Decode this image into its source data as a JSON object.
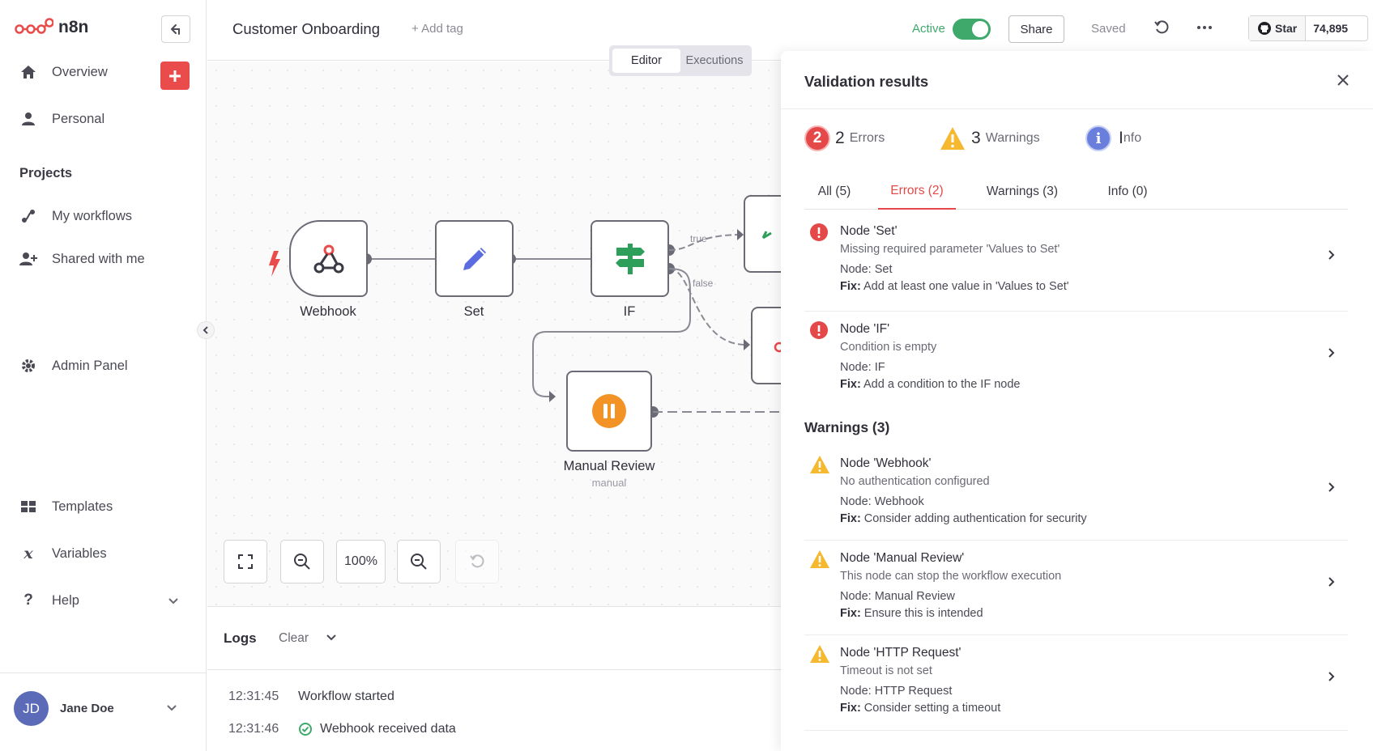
{
  "app": {
    "brand": "n8n"
  },
  "sidebar": {
    "items": [
      {
        "label": "Overview",
        "icon": "home-icon"
      },
      {
        "label": "Personal",
        "icon": "user-icon"
      }
    ],
    "projects_title": "Projects",
    "project_items": [
      {
        "label": "My workflows",
        "icon": "workflow-icon"
      },
      {
        "label": "Shared with me",
        "icon": "user-plus-icon"
      }
    ],
    "admin": {
      "label": "Admin Panel",
      "icon": "gear-icon"
    },
    "bottom_items": [
      {
        "label": "Templates",
        "icon": "box-icon"
      },
      {
        "label": "Variables",
        "icon": "variable-icon"
      },
      {
        "label": "Help",
        "icon": "question-icon"
      }
    ],
    "user": {
      "initials": "JD",
      "name": "Jane Doe"
    }
  },
  "header": {
    "workflow_name": "Customer Onboarding",
    "add_tag": "+ Add tag",
    "active_label": "Active",
    "active": true,
    "share_label": "Share",
    "saved_label": "Saved",
    "github": {
      "star_label": "Star",
      "count": "74,895"
    }
  },
  "view_tabs": {
    "editor": "Editor",
    "executions": "Executions",
    "selected": "Editor"
  },
  "canvas": {
    "nodes": [
      {
        "id": "webhook",
        "label": "Webhook"
      },
      {
        "id": "set",
        "label": "Set"
      },
      {
        "id": "if",
        "label": "IF"
      },
      {
        "id": "manual-review",
        "label": "Manual Review",
        "sublabel": "manual"
      }
    ],
    "edge_labels": {
      "true": "true",
      "false": "false"
    },
    "zoom_label": "100%"
  },
  "logs": {
    "title": "Logs",
    "clear_label": "Clear",
    "entries": [
      {
        "time": "12:31:45",
        "message": "Workflow started",
        "status": ""
      },
      {
        "time": "12:31:46",
        "message": "Webhook received data",
        "status": "success"
      }
    ]
  },
  "validation": {
    "title": "Validation results",
    "summary": {
      "errors": {
        "count": "2",
        "label": "Errors"
      },
      "warnings": {
        "count": "3",
        "label": "Warnings"
      },
      "info": {
        "count": "I",
        "label": "nfo"
      }
    },
    "tabs": [
      "All (5)",
      "Errors (2)",
      "Warnings (3)",
      "Info (0)"
    ],
    "active_tab": "Errors (2)",
    "errors": [
      {
        "title": "Node 'Set'",
        "desc": "Missing required parameter 'Values to Set'",
        "node": "Node: Set",
        "fix_label": "Fix:",
        "fix": " Add at least one value in 'Values to Set'"
      },
      {
        "title": "Node 'IF'",
        "desc": "Condition is empty",
        "node": "Node: IF",
        "fix_label": "Fix:",
        "fix": " Add a condition to the IF node"
      }
    ],
    "warnings_heading": "Warnings (3)",
    "warnings": [
      {
        "title": "Node 'Webhook'",
        "desc": "No authentication configured",
        "node": "Node: Webhook",
        "fix_label": "Fix:",
        "fix": " Consider adding authentication for security"
      },
      {
        "title": "Node 'Manual Review'",
        "desc": "This node can stop the workflow execution",
        "node": "Node: Manual Review",
        "fix_label": "Fix:",
        "fix": " Ensure this is intended"
      },
      {
        "title": "Node 'HTTP Request'",
        "desc": "Timeout is not set",
        "node": "Node: HTTP Request",
        "fix_label": "Fix:",
        "fix": " Consider setting a timeout"
      }
    ]
  },
  "colors": {
    "brand_red": "#ea4b4b",
    "error": "#e54848",
    "warning": "#f5b82e",
    "info": "#6a7fdc",
    "active_green": "#3fa86b",
    "set_blue": "#5b6be0",
    "if_green": "#2e9e5b",
    "manual_orange": "#f39325"
  }
}
